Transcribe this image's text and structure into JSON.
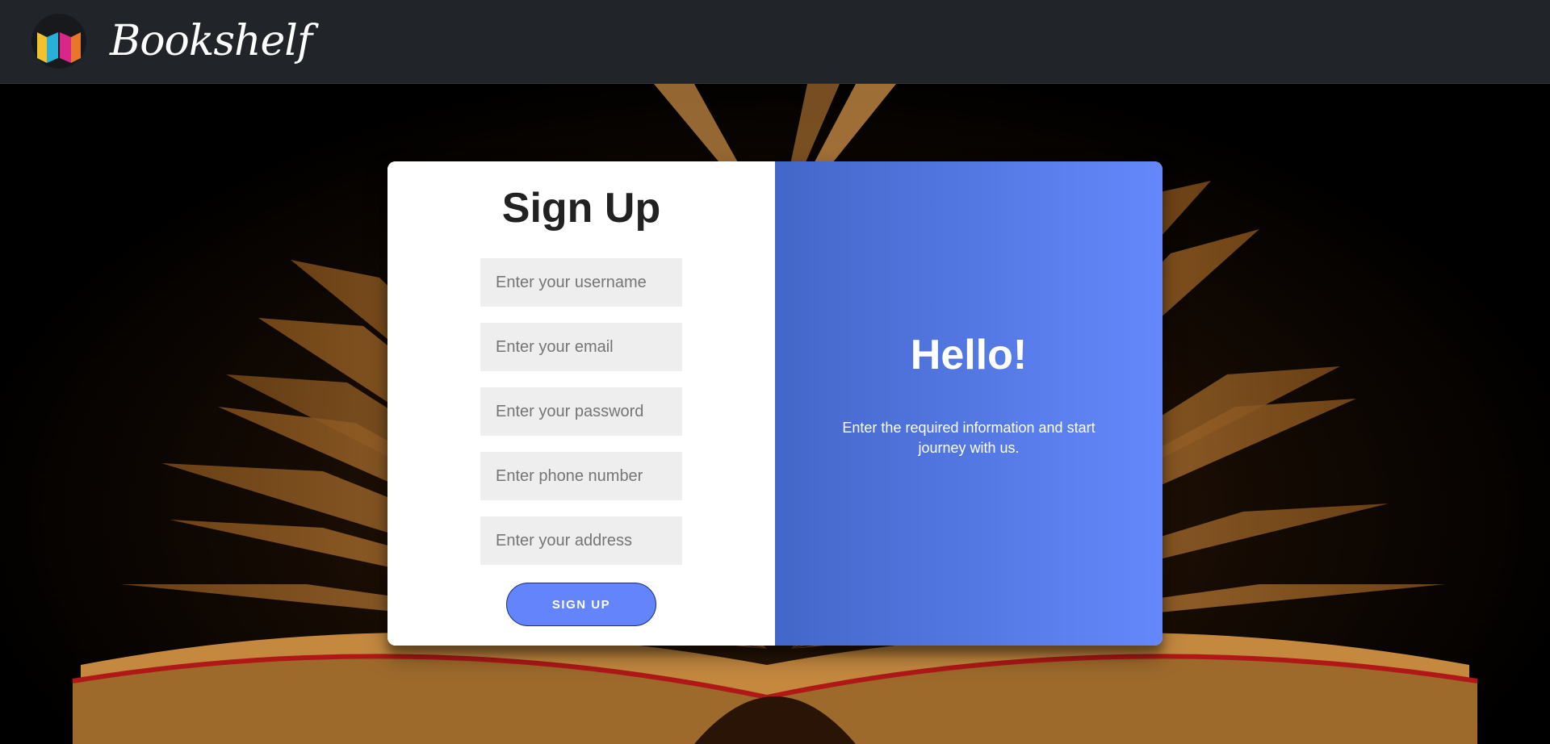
{
  "header": {
    "brand": "Bookshelf",
    "logo_icon": "book-logo-icon"
  },
  "signup": {
    "title": "Sign Up",
    "fields": {
      "username_placeholder": "Enter your username",
      "email_placeholder": "Enter your email",
      "password_placeholder": "Enter your password",
      "phone_placeholder": "Enter phone number",
      "address_placeholder": "Enter your address"
    },
    "submit_label": "SIGN UP"
  },
  "overlay": {
    "title": "Hello!",
    "text": "Enter the required information and start journey with us."
  },
  "colors": {
    "navbar": "#212529",
    "button": "#6384fb",
    "overlay_start": "#4367c8",
    "overlay_end": "#6488fb"
  }
}
